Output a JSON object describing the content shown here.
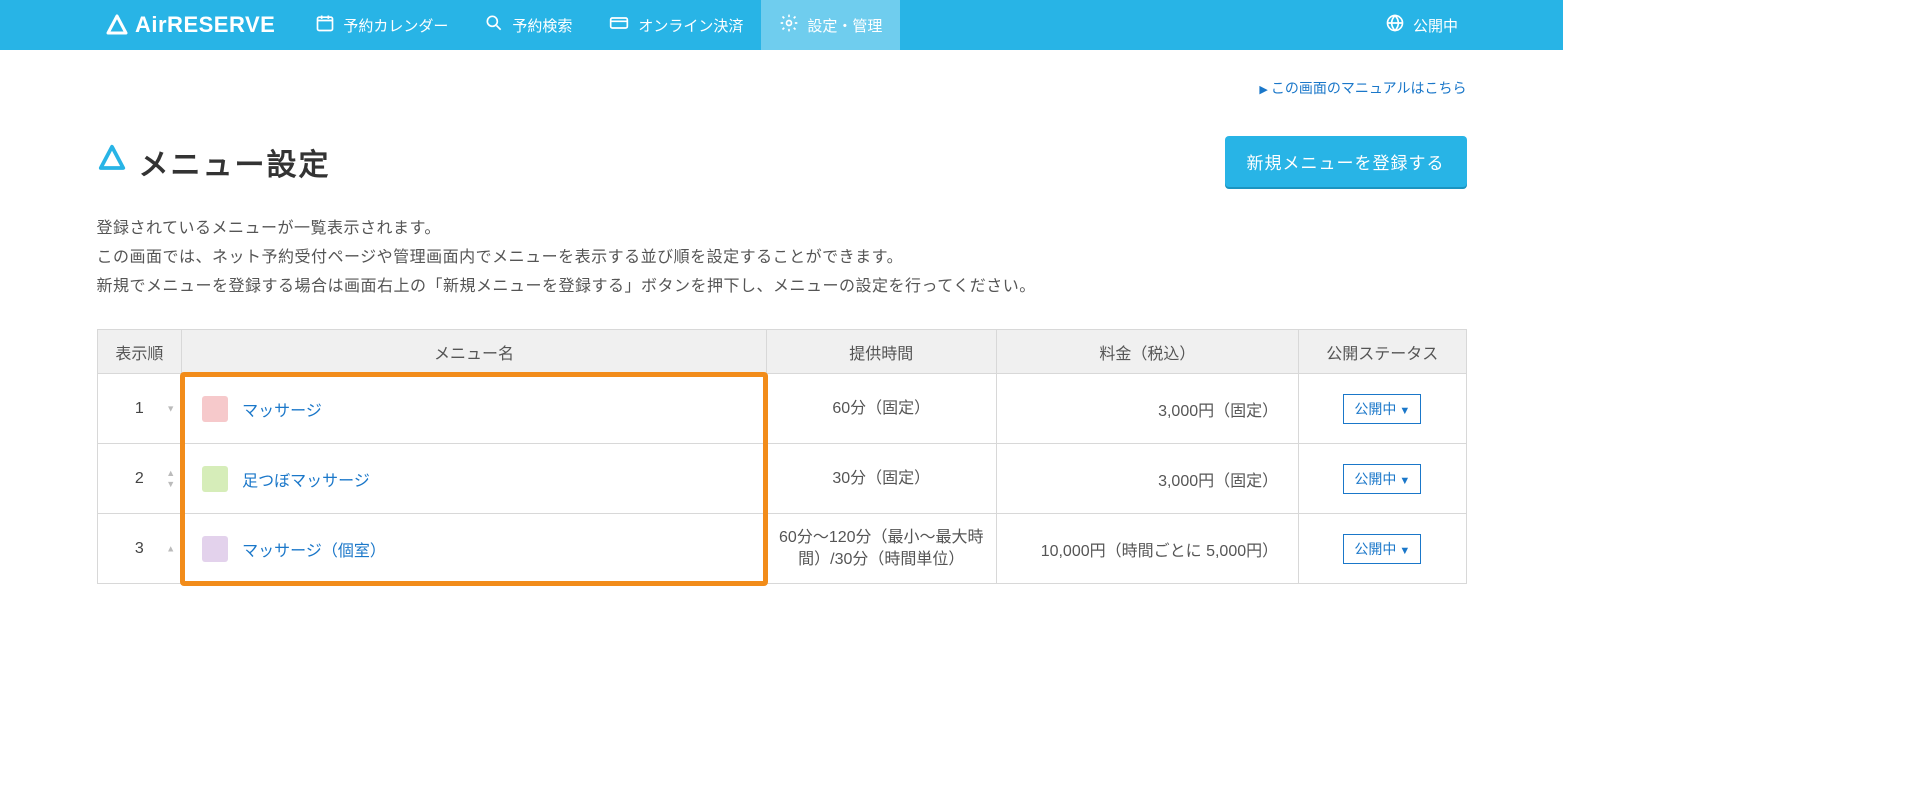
{
  "brand": {
    "name": "AirRESERVE"
  },
  "header": {
    "nav": [
      {
        "label": "予約カレンダー"
      },
      {
        "label": "予約検索"
      },
      {
        "label": "オンライン決済"
      },
      {
        "label": "設定・管理"
      }
    ],
    "status_label": "公開中"
  },
  "manual_link": "この画面のマニュアルはこちら",
  "page": {
    "title": "メニュー設定",
    "register_button": "新規メニューを登録する",
    "description_line1": "登録されているメニューが一覧表示されます。",
    "description_line2": "この画面では、ネット予約受付ページや管理画面内でメニューを表示する並び順を設定することができます。",
    "description_line3": "新規でメニューを登録する場合は画面右上の「新規メニューを登録する」ボタンを押下し、メニューの設定を行ってください。"
  },
  "table": {
    "columns": {
      "order": "表示順",
      "name": "メニュー名",
      "time": "提供時間",
      "price": "料金（税込）",
      "status": "公開ステータス"
    },
    "rows": [
      {
        "order": "1",
        "swatch": "#f6c9cb",
        "name": "マッサージ",
        "time": "60分（固定）",
        "price": "3,000円（固定）",
        "status": "公開中",
        "up": false,
        "down": true
      },
      {
        "order": "2",
        "swatch": "#d6edb9",
        "name": "足つぼマッサージ",
        "time": "30分（固定）",
        "price": "3,000円（固定）",
        "status": "公開中",
        "up": true,
        "down": true
      },
      {
        "order": "3",
        "swatch": "#e3d2ec",
        "name": "マッサージ（個室）",
        "time": "60分〜120分（最小〜最大時間）/30分（時間単位）",
        "price": "10,000円（時間ごとに 5,000円）",
        "status": "公開中",
        "up": true,
        "down": false
      }
    ]
  }
}
